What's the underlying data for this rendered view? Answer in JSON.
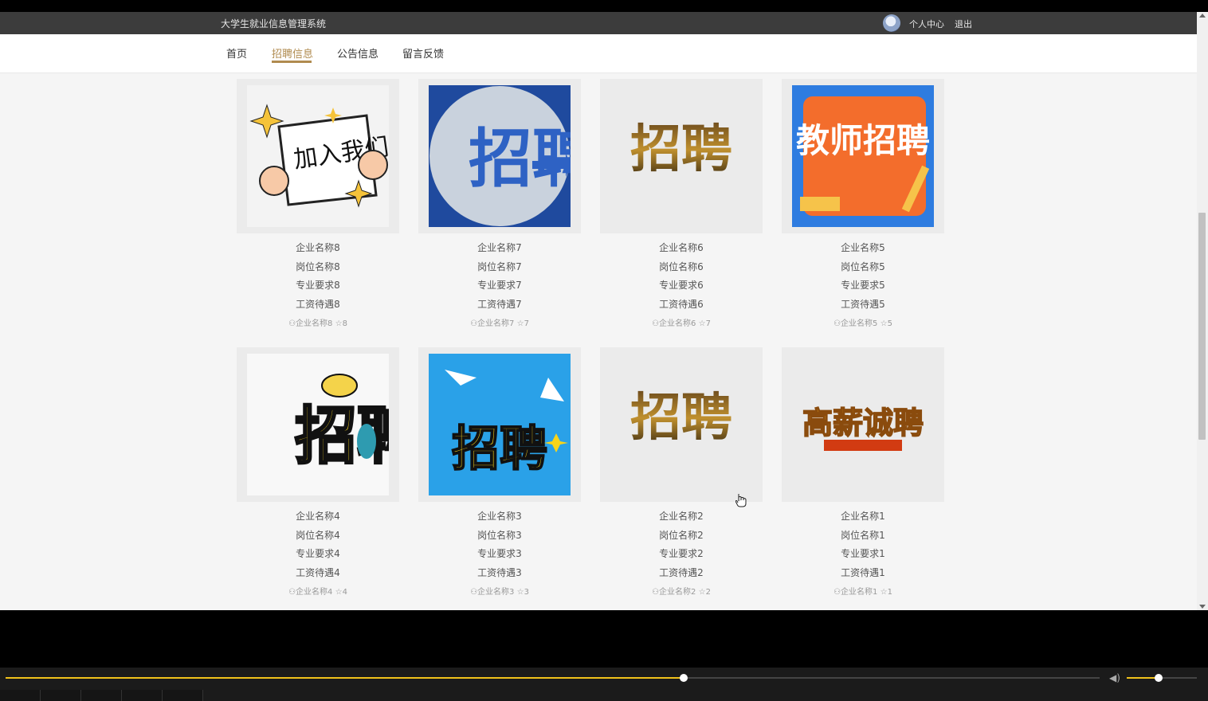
{
  "header": {
    "title": "大学生就业信息管理系统",
    "personal_center": "个人中心",
    "logout": "退出"
  },
  "nav": {
    "items": [
      {
        "label": "首页",
        "active": false
      },
      {
        "label": "招聘信息",
        "active": true
      },
      {
        "label": "公告信息",
        "active": false
      },
      {
        "label": "留言反馈",
        "active": false
      }
    ],
    "accent": "#b08b4f"
  },
  "cards": [
    {
      "image_text": "加入我们",
      "company": "企业名称8",
      "position": "岗位名称8",
      "major": "专业要求8",
      "salary": "工资待遇8",
      "meta_company": "企业名称8",
      "meta_count": "8"
    },
    {
      "image_text": "招聘",
      "company": "企业名称7",
      "position": "岗位名称7",
      "major": "专业要求7",
      "salary": "工资待遇7",
      "meta_company": "企业名称7",
      "meta_count": "7"
    },
    {
      "image_text": "招聘",
      "company": "企业名称6",
      "position": "岗位名称6",
      "major": "专业要求6",
      "salary": "工资待遇6",
      "meta_company": "企业名称6",
      "meta_count": "7"
    },
    {
      "image_text": "教师招聘",
      "company": "企业名称5",
      "position": "岗位名称5",
      "major": "专业要求5",
      "salary": "工资待遇5",
      "meta_company": "企业名称5",
      "meta_count": "5"
    },
    {
      "image_text": "招聘",
      "company": "企业名称4",
      "position": "岗位名称4",
      "major": "专业要求4",
      "salary": "工资待遇4",
      "meta_company": "企业名称4",
      "meta_count": "4"
    },
    {
      "image_text": "招聘",
      "company": "企业名称3",
      "position": "岗位名称3",
      "major": "专业要求3",
      "salary": "工资待遇3",
      "meta_company": "企业名称3",
      "meta_count": "3"
    },
    {
      "image_text": "招聘",
      "company": "企业名称2",
      "position": "岗位名称2",
      "major": "专业要求2",
      "salary": "工资待遇2",
      "meta_company": "企业名称2",
      "meta_count": "2"
    },
    {
      "image_text": "高薪诚聘",
      "company": "企业名称1",
      "position": "岗位名称1",
      "major": "专业要求1",
      "salary": "工资待遇1",
      "meta_company": "企业名称1",
      "meta_count": "1"
    }
  ],
  "player": {
    "progress": 0.62,
    "volume": 0.45,
    "accent": "#f1c21b"
  }
}
